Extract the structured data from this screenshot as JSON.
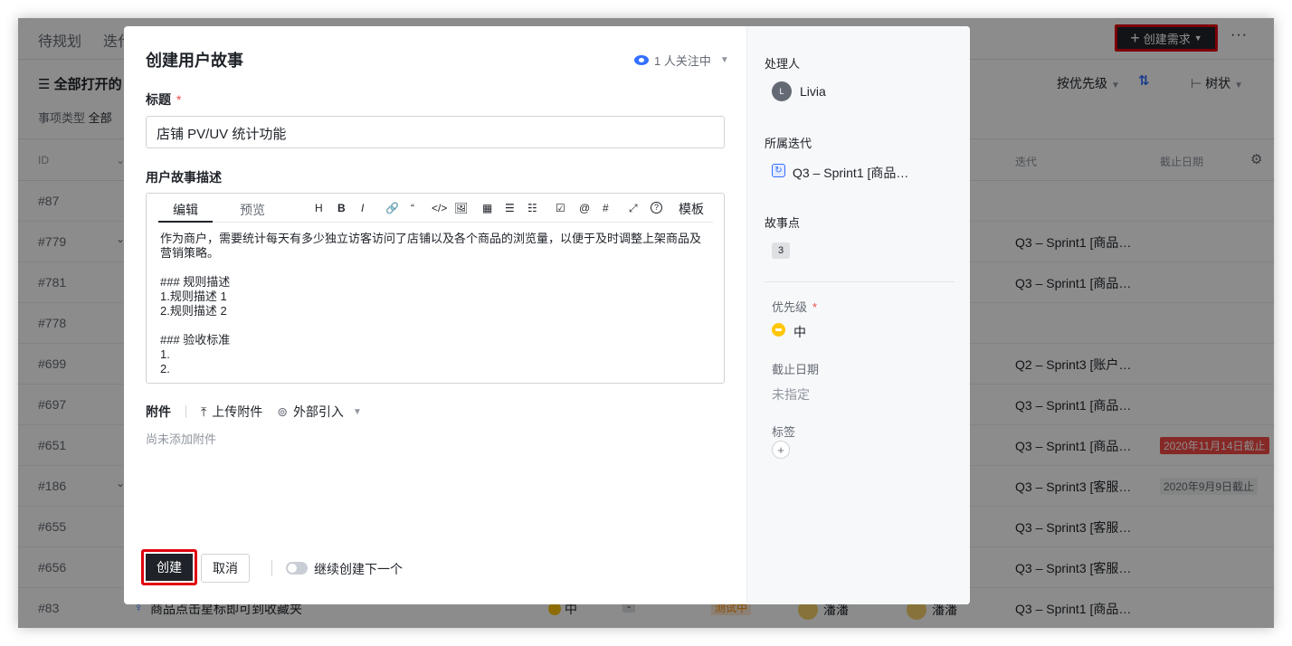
{
  "background": {
    "tabs": [
      "待规划",
      "迭代"
    ],
    "create_button": "创建需求",
    "more_button": "···",
    "filter_title": "全部打开的",
    "filter_type_label": "事项类型",
    "filter_type_value": "全部",
    "sort_label": "按优先级",
    "tree_label": "树状",
    "columns": {
      "id": "ID",
      "iteration": "迭代",
      "due": "截止日期"
    },
    "rows": [
      {
        "id": "#87",
        "iteration": "",
        "due": ""
      },
      {
        "id": "#779",
        "iteration": "Q3 – Sprint1 [商品…",
        "due": ""
      },
      {
        "id": "#781",
        "iteration": "Q3 – Sprint1 [商品…",
        "due": ""
      },
      {
        "id": "#778",
        "iteration": "",
        "due": ""
      },
      {
        "id": "#699",
        "iteration": "Q2 – Sprint3 [账户…",
        "due": ""
      },
      {
        "id": "#697",
        "iteration": "Q3 – Sprint1 [商品…",
        "due": ""
      },
      {
        "id": "#651",
        "iteration": "Q3 – Sprint1 [商品…",
        "due": "2020年11月14日截止"
      },
      {
        "id": "#186",
        "iteration": "Q3 – Sprint3 [客服…",
        "due": "2020年9月9日截止"
      },
      {
        "id": "#655",
        "iteration": "Q3 – Sprint3 [客服…",
        "due": ""
      },
      {
        "id": "#656",
        "iteration": "Q3 – Sprint3 [客服…",
        "due": ""
      },
      {
        "id": "#83",
        "iteration": "Q3 – Sprint1 [商品…",
        "due": ""
      }
    ],
    "last_row": {
      "title": "商品点击星标即可到收藏夹",
      "priority": "中",
      "points": "-",
      "status": "测试中",
      "assignee": "潘潘",
      "owner": "潘潘"
    }
  },
  "modal": {
    "title": "创建用户故事",
    "follow_text": "1 人关注中",
    "title_label": "标题",
    "required_mark": "*",
    "title_value": "店铺 PV/UV 统计功能",
    "desc_label": "用户故事描述",
    "editor_tabs": [
      "编辑",
      "预览"
    ],
    "toolbar": [
      "H",
      "B",
      "I",
      "🔗",
      "“",
      "</>",
      "🖼",
      "▦",
      "☰",
      "☷",
      "☑",
      "@",
      "#",
      "⤢",
      "?"
    ],
    "template_label": "模板",
    "desc_content": "作为商户，需要统计每天有多少独立访客访问了店铺以及各个商品的浏览量，以便于及时调整上架商品及营销策略。\n\n### 规则描述\n1.规则描述 1\n2.规则描述 2\n\n### 验收标准\n1.\n2.",
    "attachment_label": "附件",
    "upload_label": "上传附件",
    "external_label": "外部引入",
    "no_attachment": "尚未添加附件",
    "submit_label": "创建",
    "cancel_label": "取消",
    "continue_label": "继续创建下一个"
  },
  "sidebar": {
    "assignee_label": "处理人",
    "assignee_name": "Livia",
    "assignee_initial": "L",
    "iteration_label": "所属迭代",
    "iteration_value": "Q3 – Sprint1 [商品…",
    "points_label": "故事点",
    "points_value": "3",
    "priority_label": "优先级",
    "priority_value": "中",
    "due_label": "截止日期",
    "due_placeholder": "未指定",
    "tags_label": "标签"
  },
  "colors": {
    "accent": "#3370ff",
    "highlight": "#e0000f",
    "dark_button": "#1f2329",
    "priority_medium": "#ffc60a",
    "overdue": "#f54a45"
  }
}
